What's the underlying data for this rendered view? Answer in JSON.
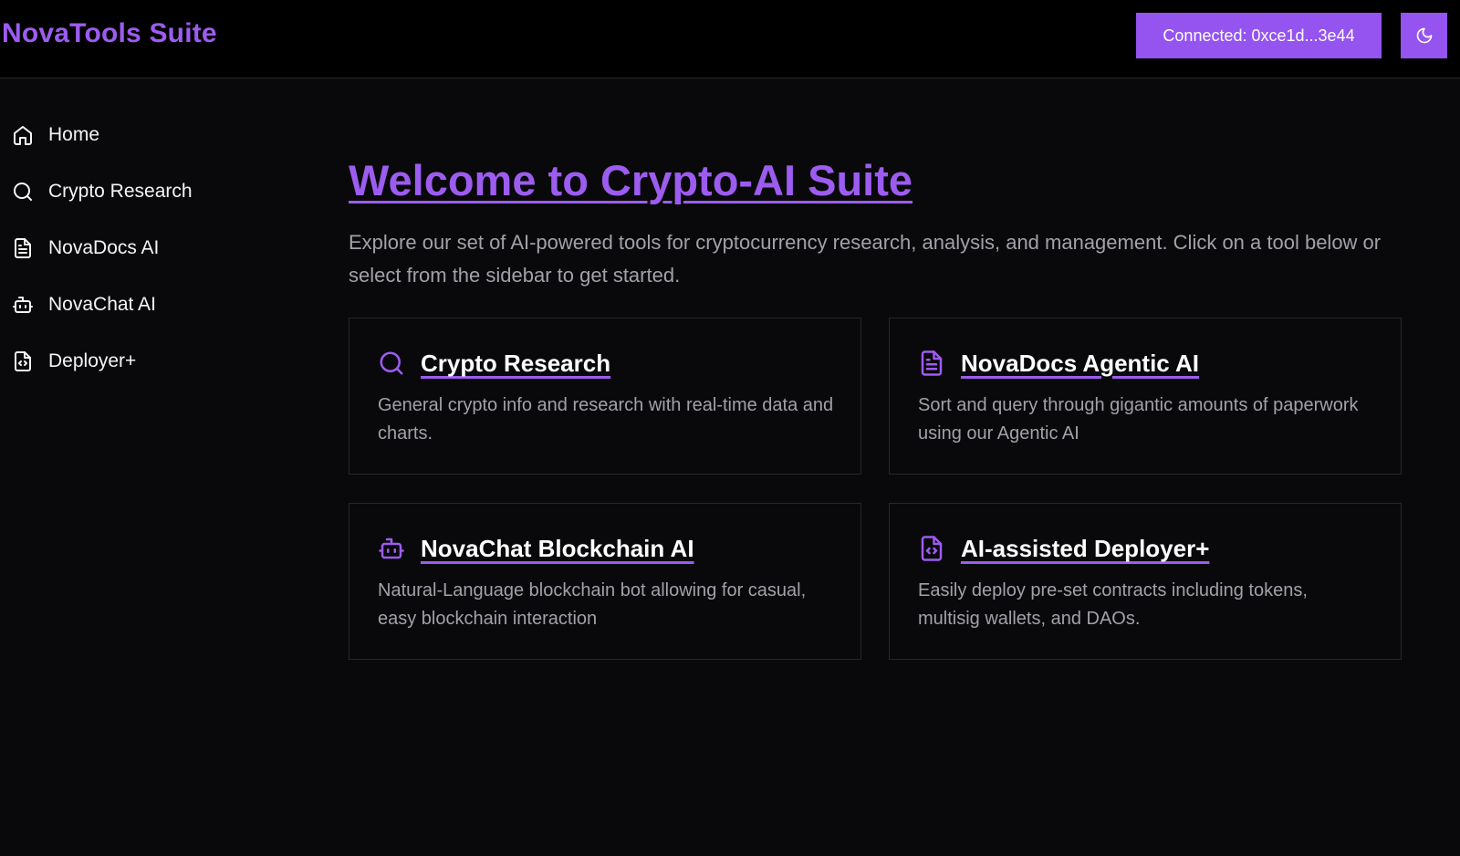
{
  "header": {
    "brand": "NovaTools Suite",
    "connect_label": "Connected: 0xce1d...3e44",
    "theme_icon": "moon-icon"
  },
  "sidebar": {
    "items": [
      {
        "label": "Home",
        "icon": "home-icon"
      },
      {
        "label": "Crypto Research",
        "icon": "search-icon"
      },
      {
        "label": "NovaDocs AI",
        "icon": "document-icon"
      },
      {
        "label": "NovaChat AI",
        "icon": "bot-icon"
      },
      {
        "label": "Deployer+",
        "icon": "code-file-icon"
      }
    ]
  },
  "main": {
    "title": "Welcome to Crypto-AI Suite",
    "description": "Explore our set of AI-powered tools for cryptocurrency research, analysis, and management. Click on a tool below or select from the sidebar to get started.",
    "cards": [
      {
        "title": "Crypto Research",
        "description": "General crypto info and research with real-time data and charts.",
        "icon": "search-icon"
      },
      {
        "title": "NovaDocs Agentic AI",
        "description": "Sort and query through gigantic amounts of paperwork using our Agentic AI",
        "icon": "document-icon"
      },
      {
        "title": "NovaChat Blockchain AI",
        "description": "Natural-Language blockchain bot allowing for casual, easy blockchain interaction",
        "icon": "bot-icon"
      },
      {
        "title": "AI-assisted Deployer+",
        "description": "Easily deploy pre-set contracts including tokens, multisig wallets, and DAOs.",
        "icon": "code-file-icon"
      }
    ]
  },
  "colors": {
    "accent": "#9d5cf0",
    "button": "#9553ef",
    "background": "#09090b",
    "muted_text": "#a1a1aa"
  }
}
